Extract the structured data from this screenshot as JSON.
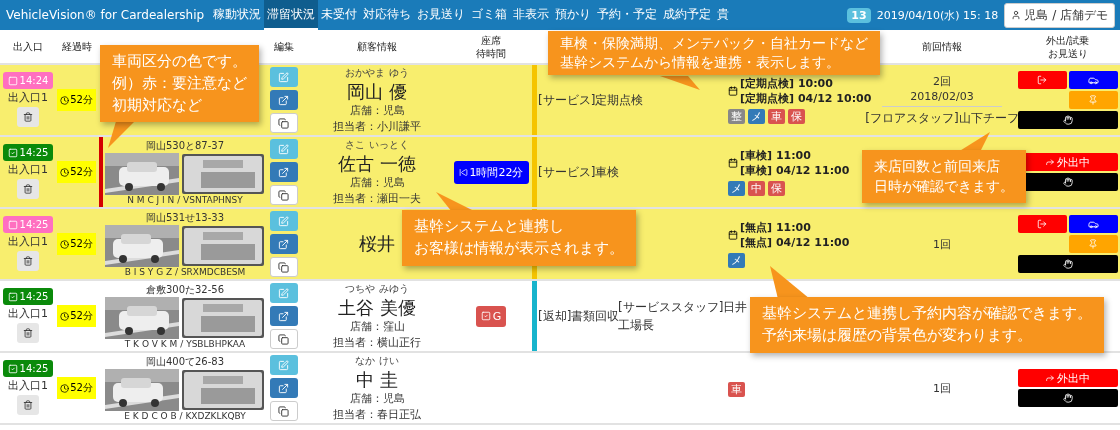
{
  "navbar": {
    "title": "VehicleVision® for Cardealership",
    "tabs": [
      {
        "label": "稼動状況",
        "selected": false
      },
      {
        "label": "滞留状況",
        "selected": true
      },
      {
        "label": "未受付",
        "selected": false
      },
      {
        "label": "対応待ち",
        "selected": false
      },
      {
        "label": "お見送り",
        "selected": false
      },
      {
        "label": "ゴミ箱",
        "selected": false
      },
      {
        "label": "非表示",
        "selected": false
      },
      {
        "label": "預かり",
        "selected": false
      },
      {
        "label": "予約・予定",
        "selected": false
      },
      {
        "label": "成約予定",
        "selected": false
      },
      {
        "label": "貴",
        "selected": false
      }
    ],
    "badge": "13",
    "datetime": "2019/04/10(水) 15: 18",
    "user": "児島 / 店舗デモ"
  },
  "columns": [
    {
      "lines": [
        "出入口"
      ]
    },
    {
      "lines": [
        "経過時"
      ]
    },
    {
      "lines": [
        "編集"
      ]
    },
    {
      "lines": [
        "顧客情報"
      ]
    },
    {
      "lines": [
        "座席",
        "待時間"
      ]
    },
    {
      "lines": [
        "前回情報"
      ]
    },
    {
      "lines": [
        "外出/試乗",
        "お見送り"
      ]
    }
  ],
  "rows": [
    {
      "reservation": true,
      "entry": {
        "time": "14:24",
        "checked": false,
        "gate": "出入口1"
      },
      "elapsed": "52分",
      "customer": {
        "kana": "おかやま ゆう",
        "name": "岡山 優",
        "store": "店舗：児島",
        "staff": "担当者：小川謙平"
      },
      "service_bar": {
        "color": "#f5c400"
      },
      "service": "[サービス]定期点検",
      "booking": {
        "lines": [
          "[定期点検] 10:00",
          "[定期点検] 04/12 10:00"
        ],
        "tags": [
          {
            "label": "整",
            "color": "#888888"
          },
          {
            "label": "メ",
            "color": "#337ab7"
          },
          {
            "label": "車",
            "color": "#d9534f"
          },
          {
            "label": "保",
            "color": "#d9534f"
          }
        ]
      },
      "previous": {
        "count": "2回",
        "date": "2018/02/03",
        "staff": "[フロアスタッフ]山下チーフ"
      },
      "actions": {
        "kind": "split"
      }
    },
    {
      "reservation": true,
      "entry": {
        "time": "14:25",
        "checked": true,
        "gate": "出入口1"
      },
      "elapsed": "52分",
      "vehicle": {
        "caption": "岡山530と87-37",
        "code": "N M C J I N / VSNTAPHNSY",
        "color": "#d40000"
      },
      "customer": {
        "kana": "さこ いっとく",
        "name": "佐古 一徳",
        "store": "店舗：児島",
        "staff": "担当者：瀬田一夫"
      },
      "seat": {
        "kind": "waiting",
        "label": "1時間22分"
      },
      "service_bar": {
        "color": "#f5c400"
      },
      "service": "[サービス]車検",
      "booking": {
        "lines": [
          "[車検] 11:00",
          "[車検] 04/12 11:00"
        ],
        "tags": [
          {
            "label": "メ",
            "color": "#337ab7"
          },
          {
            "label": "中",
            "color": "#d9534f"
          },
          {
            "label": "保",
            "color": "#d9534f"
          }
        ]
      },
      "actions": {
        "kind": "out",
        "label": "外出中"
      }
    },
    {
      "reservation": true,
      "entry": {
        "time": "14:25",
        "checked": false,
        "gate": "出入口1"
      },
      "elapsed": "52分",
      "vehicle": {
        "caption": "岡山531せ13-33",
        "code": "B I S Y G Z / SRXMDCBESM"
      },
      "customer": {
        "name": "桜井"
      },
      "service_bar": {
        "color": "#f5c400"
      },
      "booking": {
        "lines": [
          "[無点] 11:00",
          "[無点] 04/12 11:00"
        ],
        "tags": [
          {
            "label": "メ",
            "color": "#337ab7"
          }
        ]
      },
      "previous": {
        "count": "1回"
      },
      "actions": {
        "kind": "split"
      }
    },
    {
      "reservation": false,
      "entry": {
        "time": "14:25",
        "checked": true,
        "gate": "出入口1"
      },
      "elapsed": "52分",
      "vehicle": {
        "caption": "倉敷300た32-56",
        "code": "T K O V K M / YSBLBHPKAA"
      },
      "customer": {
        "kana": "つちや みゆう",
        "name": "土谷 美優",
        "store": "店舗：窪山",
        "staff": "担当者：横山正行"
      },
      "seat": {
        "kind": "reserved",
        "label": "G"
      },
      "service_bar": {
        "color": "#17b4cc"
      },
      "service": "[返却]書類回収",
      "staff": [
        "[サービススタッフ]日井",
        "工場長"
      ]
    },
    {
      "reservation": false,
      "entry": {
        "time": "14:25",
        "checked": true,
        "gate": "出入口1"
      },
      "elapsed": "52分",
      "vehicle": {
        "caption": "岡山400て26-83",
        "code": "E K D C O B / KXDZKLKQBY"
      },
      "customer": {
        "kana": "なか けい",
        "name": "中 圭",
        "store": "店舗：児島",
        "staff": "担当者：春日正弘"
      },
      "booking": {
        "tags": [
          {
            "label": "車",
            "color": "#d9534f"
          }
        ]
      },
      "previous": {
        "count": "1回"
      },
      "actions": {
        "kind": "out",
        "label": "外出中"
      }
    }
  ],
  "callouts": [
    {
      "lines": [
        "車両区分の色です。",
        "例）赤：要注意など",
        "初期対応など"
      ]
    },
    {
      "lines": [
        "車検・保険満期、メンテパック・自社カードなど",
        "基幹システムから情報を連携・表示します。"
      ]
    },
    {
      "lines": [
        "来店回数と前回来店",
        "日時が確認できます。"
      ]
    },
    {
      "lines": [
        "基幹システムと連携し",
        "お客様は情報が表示されます。"
      ]
    },
    {
      "lines": [
        "基幹システムと連携し予約内容が確認できます。",
        "予約来場は履歴の背景色が変わります。"
      ]
    }
  ]
}
